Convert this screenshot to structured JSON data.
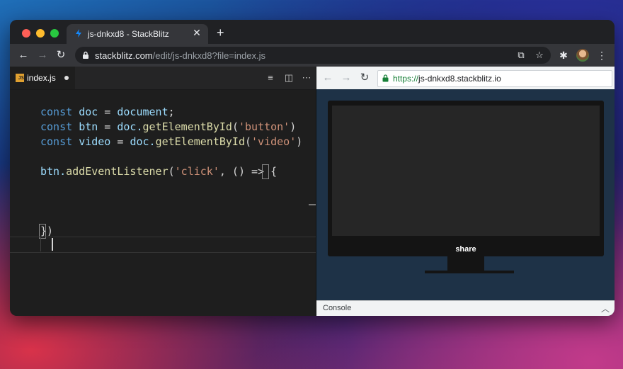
{
  "browser": {
    "tab_title": "js-dnkxd8 - StackBlitz",
    "tab_close": "✕",
    "new_tab": "+",
    "url_host": "stackblitz.com",
    "url_path": "/edit/js-dnkxd8?file=index.js"
  },
  "editor": {
    "file_badge": "JS",
    "file_name": "index.js",
    "code": {
      "line1": {
        "kw": "const",
        "var": "doc",
        "op": " = ",
        "obj": "document",
        "end": ";"
      },
      "line2": {
        "kw": "const",
        "var": "btn",
        "op": " = ",
        "obj": "doc.",
        "fn": "getElementById",
        "open": "(",
        "str": "'button'",
        "close": ")"
      },
      "line3": {
        "kw": "const",
        "var": "video",
        "op": " = ",
        "obj": "doc.",
        "fn": "getElementById",
        "open": "(",
        "str": "'video'",
        "close": ")"
      },
      "line4": {
        "obj": "btn.",
        "fn": "addEventListener",
        "open": "(",
        "str": "'click'",
        "rest": ", () => ",
        "brace": "{"
      },
      "line6": {
        "brace": "}",
        "close": ")"
      }
    }
  },
  "preview": {
    "url_scheme": "https://",
    "url_host": "js-dnkxd8.stackblitz.io",
    "share_label": "share",
    "console_label": "Console"
  },
  "colors": {
    "editor_bg": "#1e1e1e",
    "preview_bg": "#1e3247",
    "keyword": "#569cd6",
    "string": "#ce9178",
    "function": "#dcdcaa"
  }
}
